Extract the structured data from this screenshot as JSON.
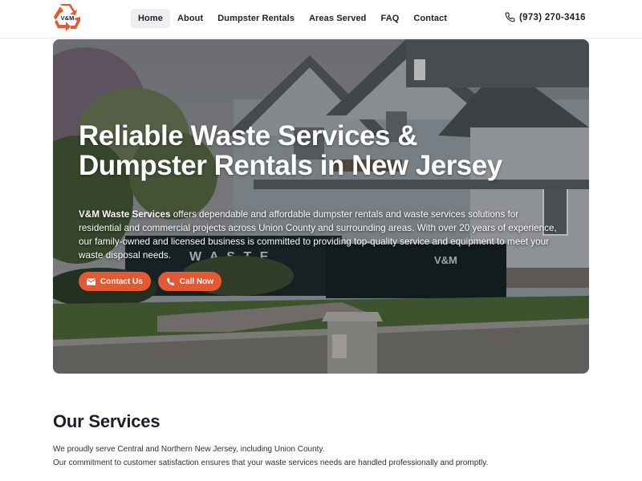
{
  "brand": {
    "logo_text": "V&M",
    "accent_color": "#e15a34",
    "icon": "recycle-logo"
  },
  "nav": {
    "items": [
      {
        "label": "Home",
        "active": true
      },
      {
        "label": "About",
        "active": false
      },
      {
        "label": "Dumpster Rentals",
        "active": false
      },
      {
        "label": "Areas Served",
        "active": false
      },
      {
        "label": "FAQ",
        "active": false
      },
      {
        "label": "Contact",
        "active": false
      }
    ],
    "phone": "(973) 270-3416",
    "phone_icon": "phone-icon"
  },
  "hero": {
    "title_line1": "Reliable Waste Services &",
    "title_line2": "Dumpster Rentals in New Jersey",
    "desc_strong": "V&M Waste Services",
    "desc_rest": " offers dependable and affordable dumpster rentals and waste services solutions for residential and commercial projects across Union County and surrounding areas. With over 20 years of experience, our family-owned and licensed business is committed to providing top-quality service and equipment to meet your waste disposal needs.",
    "dumpster_label_1": "W A S T E",
    "dumpster_label_2": "V&M",
    "button_contact": "Contact Us",
    "button_call": "Call Now"
  },
  "services": {
    "title": "Our Services",
    "line1": "We proudly serve Central and Northern New Jersey, including Union County.",
    "line2": "Our commitment to customer satisfaction ensures that your waste services needs are handled professionally and promptly."
  }
}
